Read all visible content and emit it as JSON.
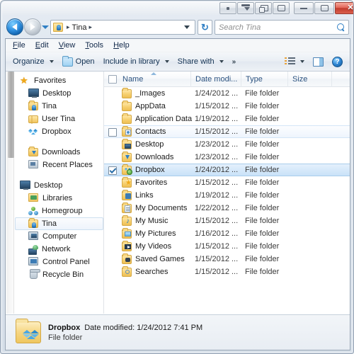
{
  "window": {
    "titlebar_buttons_extra": [
      {
        "name": "dot-button",
        "glyph": "dot"
      },
      {
        "name": "rollup-button",
        "glyph": "rollup"
      },
      {
        "name": "always-on-top-button",
        "glyph": "pin"
      },
      {
        "name": "transparency-button",
        "glyph": "box"
      }
    ],
    "minimize_label": "",
    "maximize_label": "",
    "close_label": "✕"
  },
  "navigation": {
    "back_tooltip": "Back",
    "forward_tooltip": "Forward",
    "history_tooltip": "Recent pages",
    "refresh_glyph": "↻",
    "breadcrumb": [
      {
        "label": "Tina"
      }
    ],
    "breadcrumb_sep": "▸",
    "search": {
      "placeholder": "Search Tina",
      "value": ""
    }
  },
  "menubar": {
    "items": [
      {
        "accel": "F",
        "rest": "ile"
      },
      {
        "accel": "E",
        "rest": "dit"
      },
      {
        "accel": "V",
        "rest": "iew"
      },
      {
        "accel": "T",
        "rest": "ools"
      },
      {
        "accel": "H",
        "rest": "elp"
      }
    ]
  },
  "toolbar": {
    "organize": "Organize",
    "open": "Open",
    "include_in_library": "Include in library",
    "share_with": "Share with",
    "overflow": "»",
    "views_tooltip": "Change your view",
    "preview_pane_tooltip": "Show the preview pane",
    "help_label": "?"
  },
  "sidebar": {
    "items": [
      {
        "label": "Favorites",
        "icon": "star-icon",
        "level": 0,
        "selected": false
      },
      {
        "label": "Desktop",
        "icon": "monitor-icon",
        "level": 1,
        "selected": false
      },
      {
        "label": "Tina",
        "icon": "user-folder-icon",
        "level": 1,
        "selected": false
      },
      {
        "label": "User Tina",
        "icon": "open-folder-icon",
        "level": 1,
        "selected": false
      },
      {
        "label": "Dropbox",
        "icon": "dropbox-icon",
        "level": 1,
        "selected": false
      },
      {
        "label": "",
        "icon": "spacer",
        "level": 1,
        "selected": false
      },
      {
        "label": "Downloads",
        "icon": "downloads-folder-icon",
        "level": 1,
        "selected": false
      },
      {
        "label": "Recent Places",
        "icon": "recent-places-icon",
        "level": 1,
        "selected": false
      },
      {
        "label": "",
        "icon": "spacer",
        "level": 1,
        "selected": false
      },
      {
        "label": "Desktop",
        "icon": "monitor-icon",
        "level": 0,
        "selected": false
      },
      {
        "label": "Libraries",
        "icon": "libraries-icon",
        "level": 1,
        "selected": false
      },
      {
        "label": "Homegroup",
        "icon": "homegroup-icon",
        "level": 1,
        "selected": false
      },
      {
        "label": "Tina",
        "icon": "user-folder-icon",
        "level": 1,
        "selected": true
      },
      {
        "label": "Computer",
        "icon": "computer-icon",
        "level": 1,
        "selected": false
      },
      {
        "label": "Network",
        "icon": "network-icon",
        "level": 1,
        "selected": false
      },
      {
        "label": "Control Panel",
        "icon": "control-panel-icon",
        "level": 1,
        "selected": false
      },
      {
        "label": "Recycle Bin",
        "icon": "recycle-bin-icon",
        "level": 1,
        "selected": false
      }
    ]
  },
  "filelist": {
    "columns": [
      {
        "key": "name",
        "label": "Name",
        "sorted": "asc"
      },
      {
        "key": "date",
        "label": "Date modi..."
      },
      {
        "key": "type",
        "label": "Type"
      },
      {
        "key": "size",
        "label": "Size"
      }
    ],
    "select_all_checked": false,
    "rows": [
      {
        "name": "_Images",
        "date": "1/24/2012 ...",
        "type": "File folder",
        "size": "",
        "icon": "folder-icon",
        "state": "normal",
        "checked": false
      },
      {
        "name": "AppData",
        "date": "1/15/2012 ...",
        "type": "File folder",
        "size": "",
        "icon": "folder-icon",
        "state": "normal",
        "checked": false
      },
      {
        "name": "Application Data",
        "date": "1/19/2012 ...",
        "type": "File folder",
        "size": "",
        "icon": "folder-icon",
        "state": "normal",
        "checked": false
      },
      {
        "name": "Contacts",
        "date": "1/15/2012 ...",
        "type": "File folder",
        "size": "",
        "icon": "contacts-folder-icon",
        "state": "hover",
        "checked": false
      },
      {
        "name": "Desktop",
        "date": "1/23/2012 ...",
        "type": "File folder",
        "size": "",
        "icon": "desktop-folder-icon",
        "state": "normal",
        "checked": false
      },
      {
        "name": "Downloads",
        "date": "1/23/2012 ...",
        "type": "File folder",
        "size": "",
        "icon": "downloads-folder-icon",
        "state": "normal",
        "checked": false
      },
      {
        "name": "Dropbox",
        "date": "1/24/2012 ...",
        "type": "File folder",
        "size": "",
        "icon": "dropbox-folder-icon",
        "state": "selected",
        "checked": true
      },
      {
        "name": "Favorites",
        "date": "1/15/2012 ...",
        "type": "File folder",
        "size": "",
        "icon": "favorites-folder-icon",
        "state": "normal",
        "checked": false
      },
      {
        "name": "Links",
        "date": "1/19/2012 ...",
        "type": "File folder",
        "size": "",
        "icon": "links-folder-icon",
        "state": "normal",
        "checked": false
      },
      {
        "name": "My Documents",
        "date": "1/22/2012 ...",
        "type": "File folder",
        "size": "",
        "icon": "documents-folder-icon",
        "state": "normal",
        "checked": false
      },
      {
        "name": "My Music",
        "date": "1/15/2012 ...",
        "type": "File folder",
        "size": "",
        "icon": "music-folder-icon",
        "state": "normal",
        "checked": false
      },
      {
        "name": "My Pictures",
        "date": "1/16/2012 ...",
        "type": "File folder",
        "size": "",
        "icon": "pictures-folder-icon",
        "state": "normal",
        "checked": false
      },
      {
        "name": "My Videos",
        "date": "1/15/2012 ...",
        "type": "File folder",
        "size": "",
        "icon": "videos-folder-icon",
        "state": "normal",
        "checked": false
      },
      {
        "name": "Saved Games",
        "date": "1/15/2012 ...",
        "type": "File folder",
        "size": "",
        "icon": "saved-games-folder-icon",
        "state": "normal",
        "checked": false
      },
      {
        "name": "Searches",
        "date": "1/15/2012 ...",
        "type": "File folder",
        "size": "",
        "icon": "searches-folder-icon",
        "state": "normal",
        "checked": false
      }
    ]
  },
  "details": {
    "name": "Dropbox",
    "date_modified": "Date modified: 1/24/2012 7:41 PM",
    "type": "File folder"
  },
  "colors": {
    "accent": "#2f7fc4",
    "selection": "#c9e2f8",
    "hover": "#eef5fd",
    "close_button": "#c23c2d",
    "folder": "#f6cf6e"
  }
}
